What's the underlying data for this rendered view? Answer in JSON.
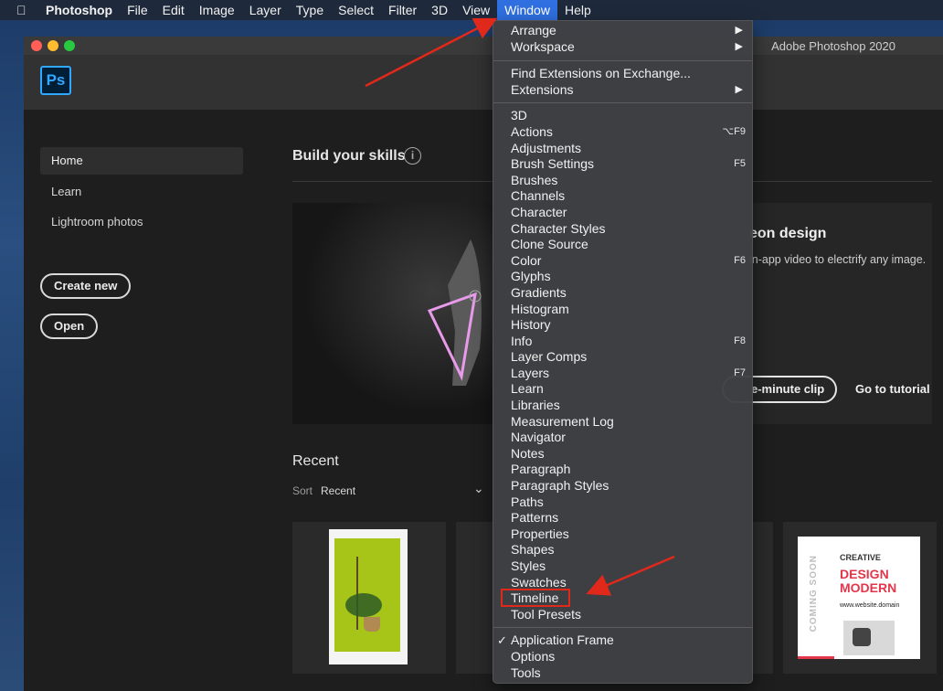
{
  "menubar": {
    "app_name": "Photoshop",
    "items": [
      "File",
      "Edit",
      "Image",
      "Layer",
      "Type",
      "Select",
      "Filter",
      "3D",
      "View",
      "Window",
      "Help"
    ],
    "active": "Window"
  },
  "window": {
    "title": "Adobe Photoshop 2020",
    "logo": "Ps"
  },
  "sidebar": {
    "items": [
      {
        "label": "Home",
        "active": true
      },
      {
        "label": "Learn",
        "active": false
      },
      {
        "label": "Lightroom photos",
        "active": false
      }
    ],
    "create_new": "Create new",
    "open": "Open"
  },
  "skills": {
    "title": "Build your skills",
    "info_icon": "i",
    "hero_title": "eon design",
    "hero_desc": "in-app video to electrify any image.",
    "clip_button": "e-minute clip",
    "tutorial_link": "Go to tutorial"
  },
  "recent": {
    "title": "Recent",
    "sort_label": "Sort",
    "sort_value": "Recent",
    "card4": {
      "coming": "COMING SOON",
      "creative": "CREATIVE",
      "design": "DESIGN MODERN",
      "site": "www.website.domain"
    }
  },
  "window_menu": {
    "group1": [
      {
        "label": "Arrange",
        "submenu": true
      },
      {
        "label": "Workspace",
        "submenu": true
      }
    ],
    "group2": [
      {
        "label": "Find Extensions on Exchange...",
        "submenu": false
      },
      {
        "label": "Extensions",
        "submenu": true
      }
    ],
    "group3": [
      {
        "label": "3D",
        "shortcut": ""
      },
      {
        "label": "Actions",
        "shortcut": "⌥F9"
      },
      {
        "label": "Adjustments",
        "shortcut": ""
      },
      {
        "label": "Brush Settings",
        "shortcut": "F5"
      },
      {
        "label": "Brushes",
        "shortcut": ""
      },
      {
        "label": "Channels",
        "shortcut": ""
      },
      {
        "label": "Character",
        "shortcut": ""
      },
      {
        "label": "Character Styles",
        "shortcut": ""
      },
      {
        "label": "Clone Source",
        "shortcut": ""
      },
      {
        "label": "Color",
        "shortcut": "F6"
      },
      {
        "label": "Glyphs",
        "shortcut": ""
      },
      {
        "label": "Gradients",
        "shortcut": ""
      },
      {
        "label": "Histogram",
        "shortcut": ""
      },
      {
        "label": "History",
        "shortcut": ""
      },
      {
        "label": "Info",
        "shortcut": "F8"
      },
      {
        "label": "Layer Comps",
        "shortcut": ""
      },
      {
        "label": "Layers",
        "shortcut": "F7"
      },
      {
        "label": "Learn",
        "shortcut": ""
      },
      {
        "label": "Libraries",
        "shortcut": ""
      },
      {
        "label": "Measurement Log",
        "shortcut": ""
      },
      {
        "label": "Navigator",
        "shortcut": ""
      },
      {
        "label": "Notes",
        "shortcut": ""
      },
      {
        "label": "Paragraph",
        "shortcut": ""
      },
      {
        "label": "Paragraph Styles",
        "shortcut": ""
      },
      {
        "label": "Paths",
        "shortcut": ""
      },
      {
        "label": "Patterns",
        "shortcut": ""
      },
      {
        "label": "Properties",
        "shortcut": ""
      },
      {
        "label": "Shapes",
        "shortcut": ""
      },
      {
        "label": "Styles",
        "shortcut": ""
      },
      {
        "label": "Swatches",
        "shortcut": ""
      },
      {
        "label": "Timeline",
        "shortcut": "",
        "highlighted": true
      },
      {
        "label": "Tool Presets",
        "shortcut": ""
      }
    ],
    "group4": [
      {
        "label": "Application Frame",
        "checked": true
      },
      {
        "label": "Options",
        "checked": false
      },
      {
        "label": "Tools",
        "checked": false
      }
    ]
  },
  "colors": {
    "menubar_active": "#2f6fe0",
    "annotation_red": "#e0281b",
    "ps_blue": "#31a8ff"
  }
}
